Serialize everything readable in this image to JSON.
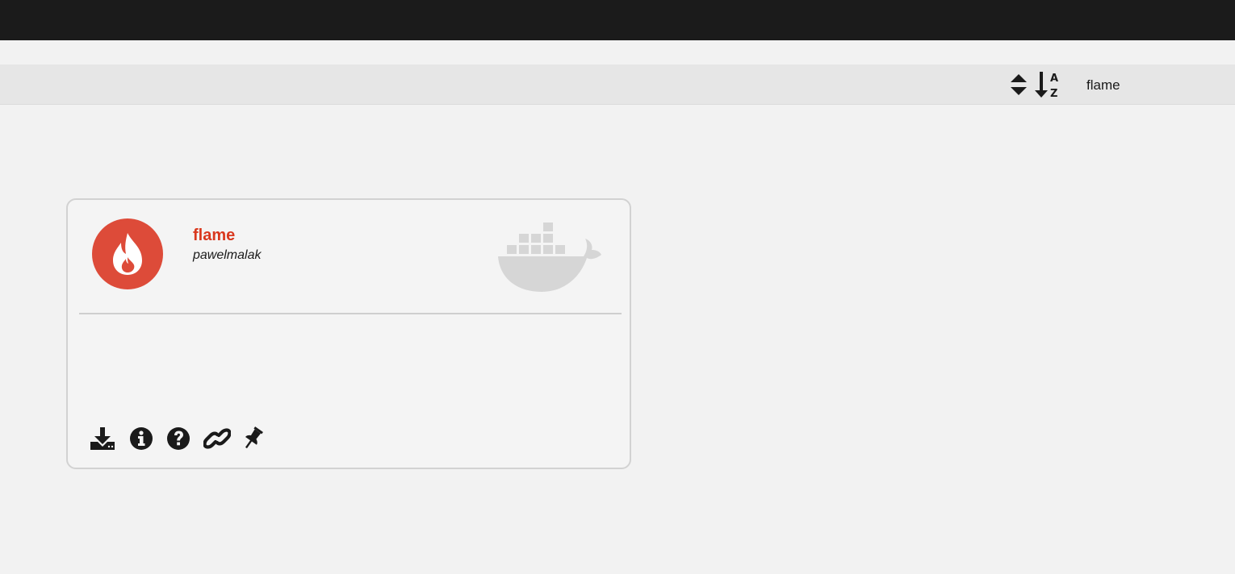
{
  "header": {
    "sort_order_icon": "sort-updown-icon",
    "sort_alpha_icon": "sort-alpha-down-icon",
    "search_value": "flame"
  },
  "card": {
    "name": "flame",
    "author": "pawelmalak",
    "logo_icon": "flame-logo-icon",
    "badge_icon": "docker-whale-icon",
    "accent_color": "#d9381e",
    "logo_color": "#dd4b39",
    "actions": [
      {
        "icon": "install-icon"
      },
      {
        "icon": "info-icon"
      },
      {
        "icon": "help-icon"
      },
      {
        "icon": "link-icon"
      },
      {
        "icon": "pin-icon"
      }
    ]
  }
}
